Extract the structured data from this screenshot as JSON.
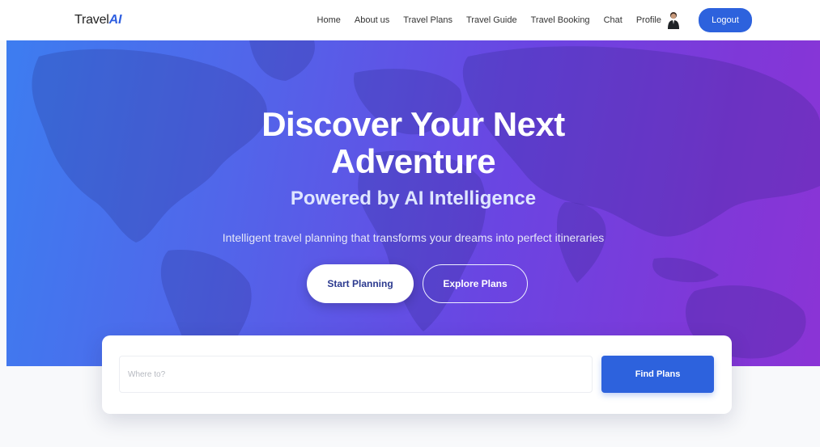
{
  "brand": {
    "prefix": "Travel",
    "accent": "AI"
  },
  "nav": {
    "items": [
      "Home",
      "About us",
      "Travel Plans",
      "Travel Guide",
      "Travel Booking",
      "Chat",
      "Profile"
    ],
    "logout_label": "Logout"
  },
  "hero": {
    "title_line1": "Discover Your Next",
    "title_line2": "Adventure",
    "subtitle": "Powered by AI Intelligence",
    "description": "Intelligent travel planning that transforms your dreams into perfect itineraries",
    "start_label": "Start Planning",
    "explore_label": "Explore Plans"
  },
  "search": {
    "placeholder": "Where to?",
    "value": "",
    "button_label": "Find Plans"
  },
  "colors": {
    "accent": "#2d62dd",
    "hero_gradient_start": "#3d7df0",
    "hero_gradient_end": "#8b34d6"
  },
  "icons": {
    "avatar": "user-avatar"
  }
}
